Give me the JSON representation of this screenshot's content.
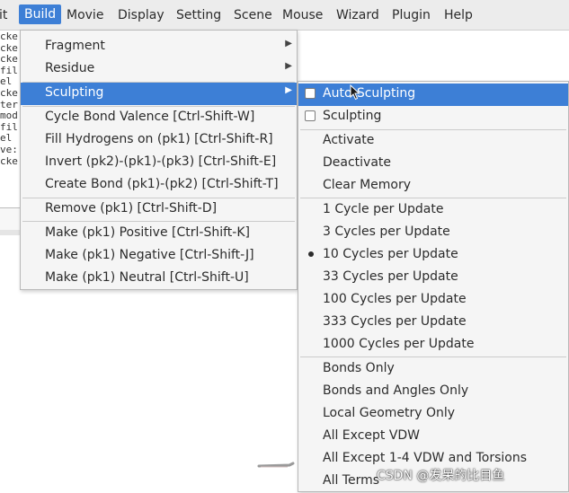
{
  "menubar": {
    "items": [
      "it",
      "Build",
      "Movie",
      "Display",
      "Setting",
      "Scene",
      "Mouse",
      "Wizard",
      "Plugin",
      "Help"
    ],
    "active": "Build"
  },
  "console_fragments": [
    "cke",
    "cke",
    "cke",
    "fil",
    " el",
    "cke",
    "ter",
    "mod",
    "fil",
    " el",
    "ve:",
    "cke"
  ],
  "build_menu": {
    "items": [
      {
        "label": "Fragment",
        "submenu": true
      },
      {
        "label": "Residue",
        "submenu": true
      },
      {
        "label": "Sculpting",
        "submenu": true,
        "highlighted": true
      },
      {
        "label": "Cycle Bond Valence [Ctrl-Shift-W]"
      },
      {
        "label": "Fill Hydrogens on (pk1) [Ctrl-Shift-R]"
      },
      {
        "label": "Invert (pk2)-(pk1)-(pk3) [Ctrl-Shift-E]"
      },
      {
        "label": "Create Bond (pk1)-(pk2) [Ctrl-Shift-T]"
      },
      {
        "label": "Remove (pk1) [Ctrl-Shift-D]"
      },
      {
        "label": "Make (pk1) Positive [Ctrl-Shift-K]"
      },
      {
        "label": "Make (pk1) Negative [Ctrl-Shift-J]"
      },
      {
        "label": "Make (pk1) Neutral [Ctrl-Shift-U]"
      }
    ]
  },
  "sculpting_menu": {
    "items": [
      {
        "label": "Auto-Sculpting",
        "control": "checkbox",
        "checked": false,
        "highlighted": true
      },
      {
        "label": "Sculpting",
        "control": "checkbox",
        "checked": false
      },
      {
        "label": "Activate"
      },
      {
        "label": "Deactivate"
      },
      {
        "label": "Clear Memory"
      },
      {
        "label": "1 Cycle per Update",
        "control": "radio",
        "selected": false
      },
      {
        "label": "3 Cycles per Update",
        "control": "radio",
        "selected": false
      },
      {
        "label": "10 Cycles per Update",
        "control": "radio",
        "selected": true
      },
      {
        "label": "33 Cycles per Update",
        "control": "radio",
        "selected": false
      },
      {
        "label": "100 Cycles per Update",
        "control": "radio",
        "selected": false
      },
      {
        "label": "333 Cycles per Update",
        "control": "radio",
        "selected": false
      },
      {
        "label": "1000 Cycles per Update",
        "control": "radio",
        "selected": false
      },
      {
        "label": "Bonds Only"
      },
      {
        "label": "Bonds and Angles Only"
      },
      {
        "label": "Local Geometry Only"
      },
      {
        "label": "All Except VDW"
      },
      {
        "label": "All Except 1-4 VDW and Torsions"
      },
      {
        "label": "All Terms"
      }
    ]
  },
  "watermark": "CSDN @发呆的比目鱼",
  "colors": {
    "highlight": "#3d7fd6",
    "menu_bg": "#f5f5f5",
    "menubar_bg": "#ececec"
  }
}
